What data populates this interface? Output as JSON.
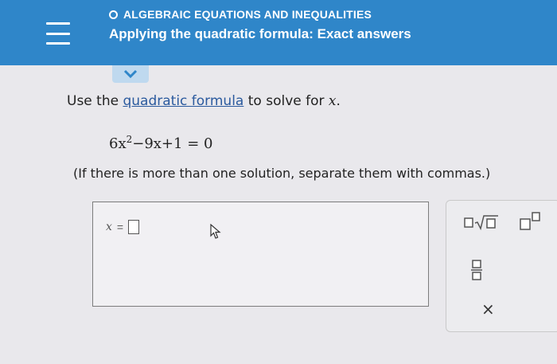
{
  "header": {
    "topic": "ALGEBRAIC EQUATIONS AND INEQUALITIES",
    "title": "Applying the quadratic formula: Exact answers",
    "menu_icon": "hamburger-menu-icon",
    "background": "#2f86c9"
  },
  "expand": {
    "icon": "chevron-down-icon"
  },
  "question": {
    "prefix": "Use the ",
    "link": "quadratic formula",
    "suffix": " to solve for ",
    "variable": "x",
    "period": ".",
    "equation_coeff": "6",
    "equation_var": "x",
    "equation_exponent": "2",
    "equation_rest": "−9x+1 = 0",
    "note": "(If there is more than one solution, separate them with commas.)"
  },
  "answer": {
    "variable": "x",
    "equals": "=",
    "value": ""
  },
  "tools": {
    "sqrt": "square-root-icon",
    "power": "exponent-icon",
    "fraction": "fraction-icon",
    "clear": "×"
  }
}
